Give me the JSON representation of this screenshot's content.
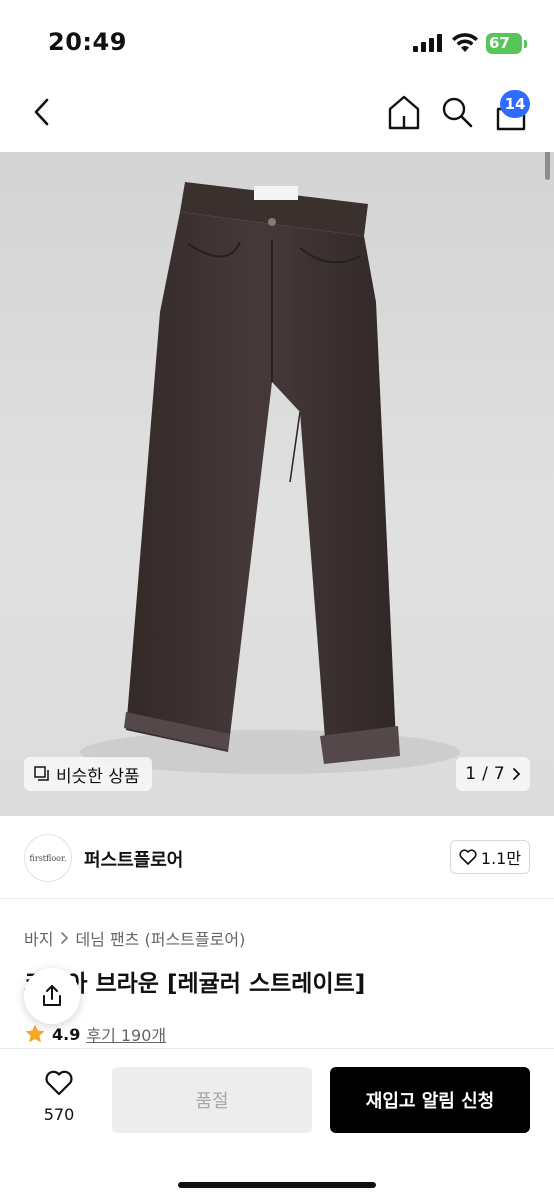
{
  "status_bar": {
    "time": "20:49",
    "battery": "67"
  },
  "header": {
    "cart_count": "14"
  },
  "gallery": {
    "similar_label": "비슷한 상품",
    "current": "1",
    "separator": "/",
    "total": "7"
  },
  "brand": {
    "logo_text": "firstfloor.",
    "name": "퍼스트플로어",
    "likes": "1.1만"
  },
  "breadcrumb": {
    "level1": "바지",
    "level2": "데님 팬츠 (퍼스트플로어)"
  },
  "product": {
    "title": "코코아 브라운 [레귤러 스트레이트]",
    "rating": "4.9",
    "reviews": "후기 190개"
  },
  "bottom_bar": {
    "wish_count": "570",
    "soldout_label": "품절",
    "restock_label": "재입고 알림 신청"
  },
  "colors": {
    "accent": "#2f6bff",
    "battery": "#57c55a",
    "star": "#f5a623",
    "pants": "#3d3331"
  }
}
